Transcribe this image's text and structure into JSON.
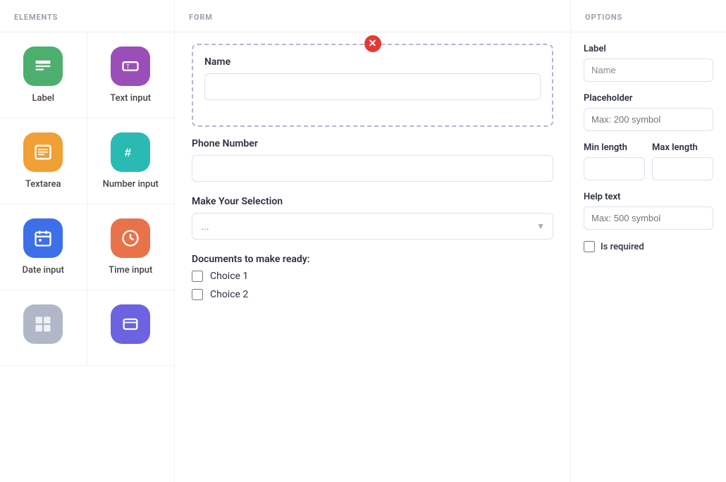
{
  "elements_panel": {
    "header": "Elements",
    "items": [
      {
        "id": "label",
        "label": "Label",
        "icon": "label-icon",
        "color": "icon-green"
      },
      {
        "id": "text-input",
        "label": "Text input",
        "icon": "text-input-icon",
        "color": "icon-purple"
      },
      {
        "id": "textarea",
        "label": "Textarea",
        "icon": "textarea-icon",
        "color": "icon-orange"
      },
      {
        "id": "number-input",
        "label": "Number input",
        "icon": "number-icon",
        "color": "icon-teal"
      },
      {
        "id": "date-input",
        "label": "Date input",
        "icon": "date-icon",
        "color": "icon-blue"
      },
      {
        "id": "time-input",
        "label": "Time input",
        "icon": "time-icon",
        "color": "icon-coral"
      },
      {
        "id": "element-7",
        "label": "",
        "icon": "element-7-icon",
        "color": "icon-gray"
      },
      {
        "id": "element-8",
        "label": "",
        "icon": "element-8-icon",
        "color": "icon-indigo"
      }
    ]
  },
  "form_panel": {
    "header": "Form",
    "name_field": {
      "label": "Name",
      "placeholder": ""
    },
    "phone_field": {
      "label": "Phone Number",
      "placeholder": ""
    },
    "selection_field": {
      "label": "Make Your Selection",
      "placeholder": "..."
    },
    "documents_field": {
      "label": "Documents to make ready:",
      "choices": [
        {
          "id": "choice1",
          "label": "Choice 1"
        },
        {
          "id": "choice2",
          "label": "Choice 2"
        }
      ]
    }
  },
  "options_panel": {
    "header": "Options",
    "label_field": {
      "label": "Label",
      "value": "Name"
    },
    "placeholder_field": {
      "label": "Placeholder",
      "placeholder": "Max: 200 symbol"
    },
    "min_length_field": {
      "label": "Min length",
      "placeholder": ""
    },
    "max_length_field": {
      "label": "Max length",
      "placeholder": ""
    },
    "help_text_field": {
      "label": "Help text",
      "placeholder": "Max: 500 symbol"
    },
    "required_label": "Is required"
  }
}
